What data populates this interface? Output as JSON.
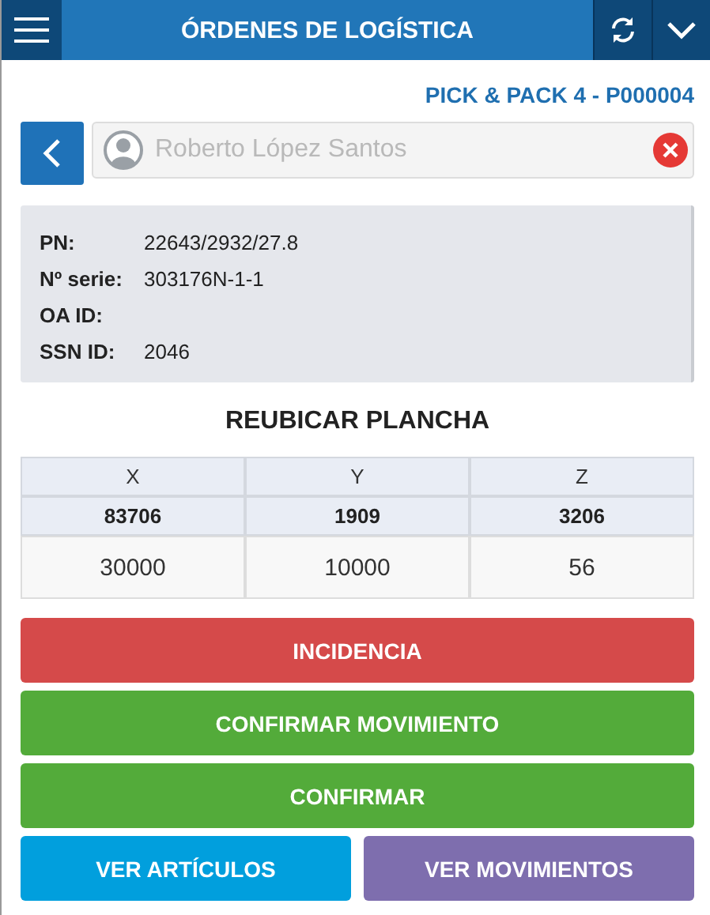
{
  "header": {
    "title": "ÓRDENES DE LOGÍSTICA"
  },
  "order": {
    "title": "PICK & PACK 4 - P000004"
  },
  "user_field": {
    "placeholder": "Roberto López Santos"
  },
  "info": [
    {
      "label": "PN:",
      "value": "22643/2932/27.8"
    },
    {
      "label": "Nº serie:",
      "value": "303176N-1-1"
    },
    {
      "label": "OA ID:"
    },
    {
      "label": "SSN ID:",
      "value": "2046"
    }
  ],
  "section_title": "REUBICAR PLANCHA",
  "table": {
    "columns": [
      "X",
      "Y",
      "Z"
    ],
    "reference": [
      "83706",
      "1909",
      "3206"
    ],
    "inputs": [
      "30000",
      "10000",
      "56"
    ]
  },
  "buttons": [
    {
      "label": "INCIDENCIA",
      "kind": "danger"
    },
    {
      "label": "CONFIRMAR MOVIMIENTO",
      "kind": "success"
    },
    {
      "label": "CONFIRMAR",
      "kind": "success"
    }
  ],
  "bottom_buttons": [
    {
      "label": "VER ARTÍCULOS",
      "kind": "info"
    },
    {
      "label": "VER MOVIMIENTOS",
      "kind": "purple"
    }
  ]
}
